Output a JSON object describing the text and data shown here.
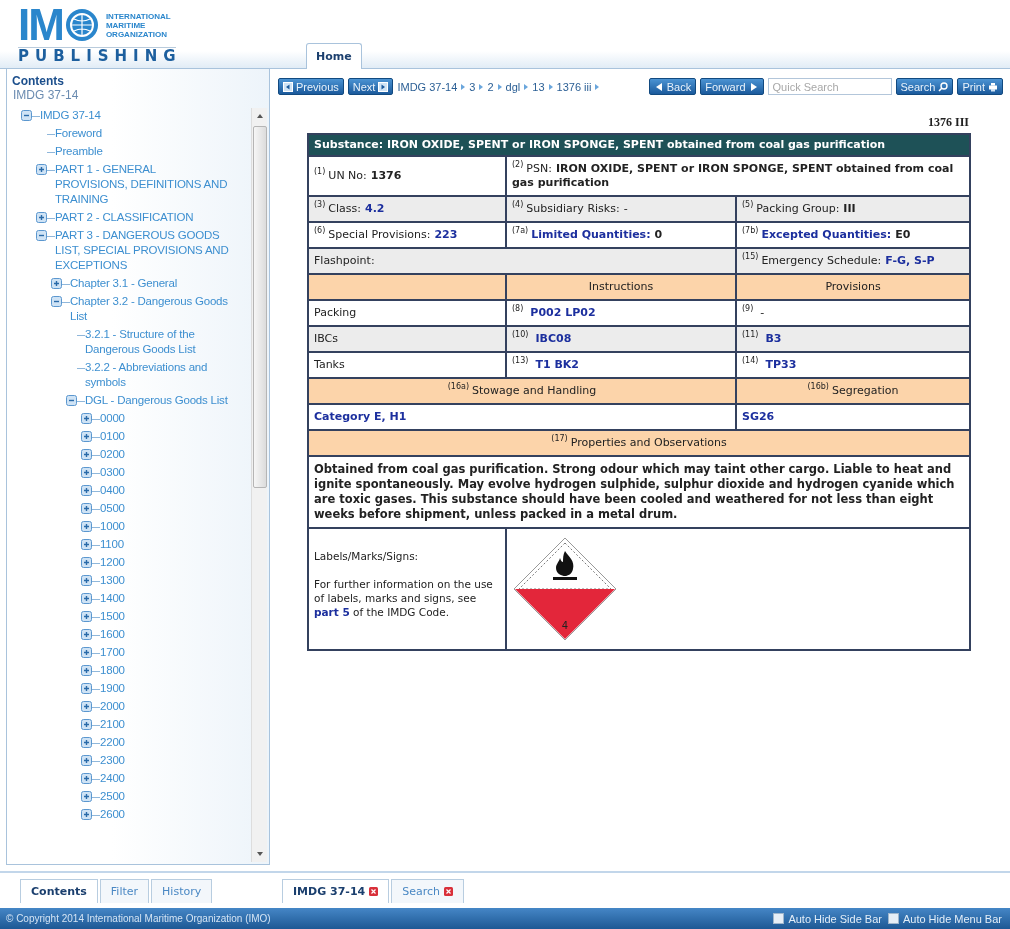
{
  "header": {
    "logo": {
      "letters": "IM",
      "org_lines": [
        "INTERNATIONAL",
        "MARITIME",
        "ORGANIZATION"
      ],
      "tagline": "PUBLISHING"
    },
    "tabs": [
      {
        "label": "Home",
        "selected": true
      }
    ]
  },
  "sidebar": {
    "title": "Contents",
    "subtitle": "IMDG 37-14",
    "tree": [
      {
        "label": "IMDG 37-14",
        "expanded": true,
        "children": [
          {
            "label": "Foreword"
          },
          {
            "label": "Preamble"
          },
          {
            "label": "PART 1 - GENERAL PROVISIONS, DEFINITIONS AND TRAINING",
            "expanded": false
          },
          {
            "label": "PART 2 - CLASSIFICATION",
            "expanded": false
          },
          {
            "label": "PART 3 - DANGEROUS GOODS LIST, SPECIAL PROVISIONS AND EXCEPTIONS",
            "expanded": true,
            "children": [
              {
                "label": "Chapter 3.1 - General",
                "expanded": false
              },
              {
                "label": "Chapter 3.2 - Dangerous Goods List",
                "expanded": true,
                "children": [
                  {
                    "label": "3.2.1 - Structure of the Dangerous Goods List"
                  },
                  {
                    "label": "3.2.2 - Abbreviations and symbols"
                  },
                  {
                    "label": "DGL - Dangerous Goods List",
                    "expanded": true,
                    "children": [
                      {
                        "label": "0000",
                        "expanded": false
                      },
                      {
                        "label": "0100",
                        "expanded": false
                      },
                      {
                        "label": "0200",
                        "expanded": false
                      },
                      {
                        "label": "0300",
                        "expanded": false
                      },
                      {
                        "label": "0400",
                        "expanded": false
                      },
                      {
                        "label": "0500",
                        "expanded": false
                      },
                      {
                        "label": "1000",
                        "expanded": false
                      },
                      {
                        "label": "1100",
                        "expanded": false
                      },
                      {
                        "label": "1200",
                        "expanded": false
                      },
                      {
                        "label": "1300",
                        "expanded": false
                      },
                      {
                        "label": "1400",
                        "expanded": false
                      },
                      {
                        "label": "1500",
                        "expanded": false
                      },
                      {
                        "label": "1600",
                        "expanded": false
                      },
                      {
                        "label": "1700",
                        "expanded": false
                      },
                      {
                        "label": "1800",
                        "expanded": false
                      },
                      {
                        "label": "1900",
                        "expanded": false
                      },
                      {
                        "label": "2000",
                        "expanded": false
                      },
                      {
                        "label": "2100",
                        "expanded": false
                      },
                      {
                        "label": "2200",
                        "expanded": false
                      },
                      {
                        "label": "2300",
                        "expanded": false
                      },
                      {
                        "label": "2400",
                        "expanded": false
                      },
                      {
                        "label": "2500",
                        "expanded": false
                      },
                      {
                        "label": "2600",
                        "expanded": false
                      }
                    ]
                  }
                ]
              }
            ]
          }
        ]
      }
    ]
  },
  "toolbar": {
    "nav_buttons": [
      {
        "label": "Previous"
      },
      {
        "label": "Next"
      }
    ],
    "breadcrumb": [
      "IMDG 37-14",
      "3",
      "2",
      "dgl",
      "13",
      "1376 iii"
    ],
    "history_buttons": [
      {
        "label": "Back"
      },
      {
        "label": "Forward"
      }
    ],
    "search": {
      "placeholder": "Quick Search"
    },
    "action_buttons": [
      {
        "label": "Search"
      },
      {
        "label": "Print"
      }
    ]
  },
  "entry": {
    "reference": "1376 III",
    "title": "Substance: IRON OXIDE, SPENT or IRON SPONGE, SPENT obtained from coal gas purification",
    "rows": [
      {
        "kind": "data",
        "shaded": false,
        "cells": [
          {
            "kind": "bold",
            "note": "(1)",
            "label": "UN No:",
            "value": "1376"
          },
          {
            "kind": "bold",
            "note": "(2)",
            "label": "PSN:",
            "value": "IRON OXIDE, SPENT or IRON SPONGE, SPENT obtained from coal gas purification"
          }
        ]
      },
      {
        "kind": "data",
        "shaded": true,
        "cells": [
          {
            "kind": "link",
            "note": "(3)",
            "label": "Class:",
            "value": "4.2"
          },
          {
            "kind": "plain",
            "note": "(4)",
            "label": "Subsidiary Risks:",
            "value": "-"
          },
          {
            "kind": "bold",
            "note": "(5)",
            "label": "Packing Group:",
            "value": "III"
          }
        ]
      },
      {
        "kind": "data",
        "shaded": false,
        "cells": [
          {
            "kind": "link",
            "note": "(6)",
            "label": "Special Provisions:",
            "value": "223"
          },
          {
            "kind": "link_label",
            "note": "(7a)",
            "label": "Limited Quantities:",
            "value": "0"
          },
          {
            "kind": "link_label",
            "note": "(7b)",
            "label": "Excepted Quantities:",
            "value": "E0"
          }
        ]
      },
      {
        "kind": "data",
        "shaded": true,
        "cells": [
          {
            "kind": "text",
            "label": "Flashpoint:"
          },
          {
            "kind": "link",
            "note": "(15)",
            "label": "Emergency Schedule:",
            "value": "F-G, S-P"
          }
        ]
      },
      {
        "kind": "header",
        "cells": [
          {
            "kind": "empty"
          },
          {
            "kind": "text",
            "label": "Instructions"
          },
          {
            "kind": "text",
            "label": "Provisions"
          }
        ]
      },
      {
        "kind": "data",
        "shaded": false,
        "cells": [
          {
            "kind": "text",
            "label": "Packing"
          },
          {
            "kind": "link",
            "note": "(8)",
            "value": "P002 LP02"
          },
          {
            "kind": "plain",
            "note": "(9)",
            "value": "-"
          }
        ]
      },
      {
        "kind": "data",
        "shaded": true,
        "cells": [
          {
            "kind": "text",
            "label": "IBCs"
          },
          {
            "kind": "link",
            "note": "(10)",
            "value": "IBC08"
          },
          {
            "kind": "link",
            "note": "(11)",
            "value": "B3"
          }
        ]
      },
      {
        "kind": "data",
        "shaded": false,
        "cells": [
          {
            "kind": "text",
            "label": "Tanks"
          },
          {
            "kind": "link",
            "note": "(13)",
            "value": "T1 BK2"
          },
          {
            "kind": "link",
            "note": "(14)",
            "value": "TP33"
          }
        ]
      },
      {
        "kind": "header",
        "cells": [
          {
            "kind": "text",
            "note": "(16a)",
            "label": "Stowage and Handling"
          },
          {
            "kind": "text",
            "note": "(16b)",
            "label": "Segregation"
          }
        ]
      },
      {
        "kind": "data",
        "shaded": false,
        "cells": [
          {
            "kind": "link",
            "value": "Category E, H1"
          },
          {
            "kind": "link",
            "value": "SG26"
          }
        ]
      },
      {
        "kind": "header",
        "cells": [
          {
            "kind": "text",
            "note": "(17)",
            "label": "Properties and Observations"
          }
        ]
      },
      {
        "kind": "paragraph",
        "text": "Obtained from coal gas purification. Strong odour which may taint other cargo. Liable to heat and ignite spontaneously. May evolve hydrogen sulphide, sulphur dioxide and hydrogen cyanide which are toxic gases. This substance should have been cooled and weathered for not less than eight weeks before shipment, unless packed in a metal drum."
      },
      {
        "kind": "labels",
        "heading": "Labels/Marks/Signs:",
        "info_before": "For further information on the use of labels, marks and signs, see",
        "info_link": "part 5",
        "info_after": "of the IMDG Code.",
        "hazard_class": "4"
      }
    ]
  },
  "bottom_tabs": {
    "panel_tabs": [
      {
        "label": "Contents",
        "selected": true
      },
      {
        "label": "Filter",
        "selected": false
      },
      {
        "label": "History",
        "selected": false
      }
    ],
    "document_tabs": [
      {
        "label": "IMDG 37-14",
        "selected": true
      },
      {
        "label": "Search",
        "selected": false
      }
    ]
  },
  "status_bar": {
    "copyright": "© Copyright 2014 International Maritime Organization (IMO)",
    "options": [
      {
        "label": "Auto Hide Side Bar",
        "checked": false
      },
      {
        "label": "Auto Hide Menu Bar",
        "checked": false
      }
    ]
  }
}
